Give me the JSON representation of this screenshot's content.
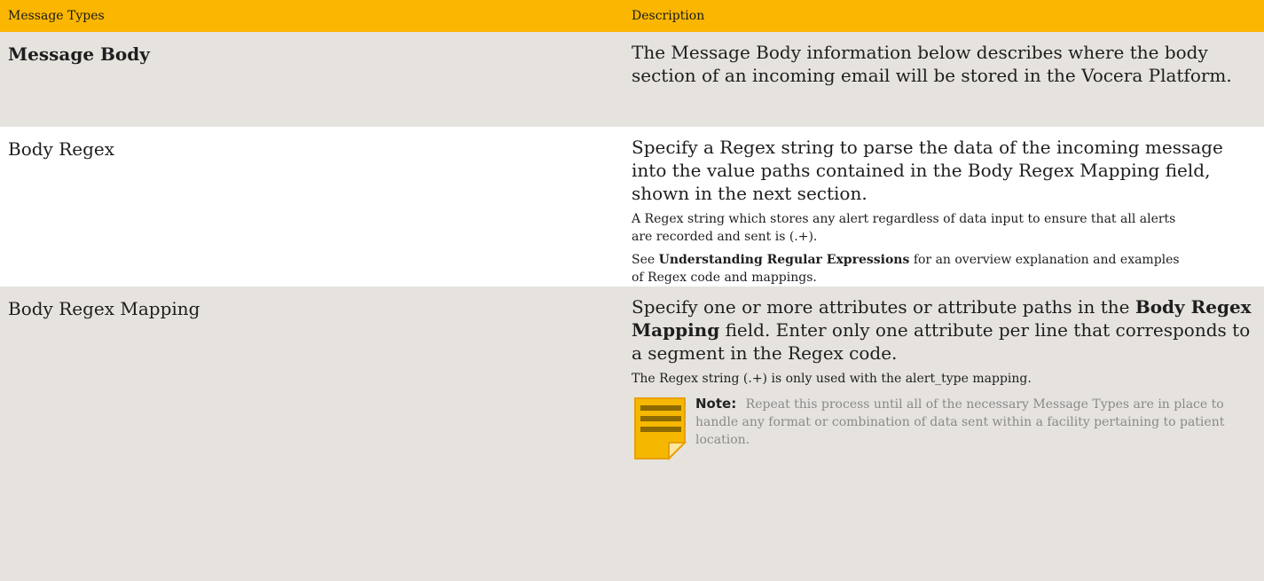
{
  "header": {
    "col1": "Message Types",
    "col2": "Description"
  },
  "rows": [
    {
      "name": "Message Body",
      "desc": "The Message Body information below describes where the body section of an incoming email will be stored in the Vocera Platform."
    },
    {
      "name": "Body Regex",
      "desc": "Specify a Regex string to parse the data of the incoming message into the value paths contained in the Body Regex Mapping field, shown in the next section.",
      "note1": "A Regex string which stores any alert regardless of data input to ensure that all alerts are recorded and sent is (.+).",
      "note2_prefix": "See",
      "note2_link": "Understanding Regular Expressions",
      "note2_suffix": "for an overview explanation and examples of Regex code and mappings."
    },
    {
      "name": "Body Regex Mapping",
      "desc_prefix": "Specify one or more attributes or attribute paths in the",
      "desc_bold": "Body Regex Mapping",
      "desc_suffix": "field. Enter only one attribute per line that corresponds to a segment in the Regex code.",
      "note1": "The Regex string (.+) is only used with the alert_type mapping.",
      "callout_label": "Note:",
      "callout_text": "Repeat this process until all of the necessary Message Types are in place to handle any format or combination of data sent within a facility pertaining to patient location."
    }
  ],
  "colors": {
    "header_bg": "#fab600",
    "row_grey": "#e6e3df",
    "note_icon": "#f5b700"
  },
  "icons": {
    "note": "note-icon"
  }
}
